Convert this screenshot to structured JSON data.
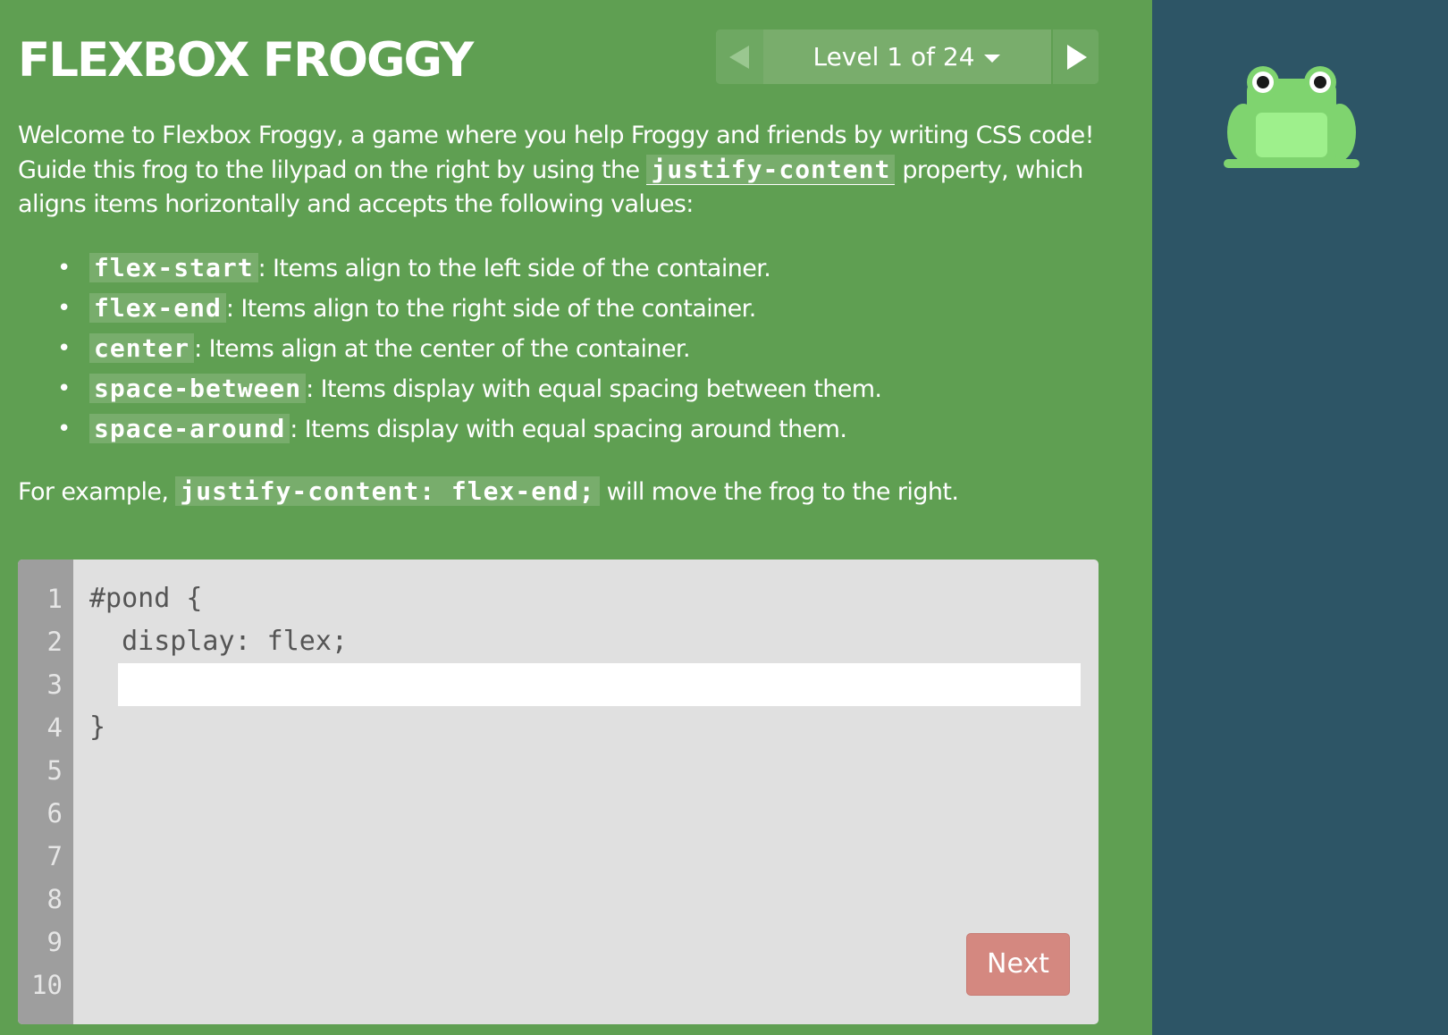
{
  "header": {
    "title": "FLEXBOX FROGGY",
    "level_label": "Level 1 of 24",
    "prev_icon": "triangle-left-icon",
    "next_icon": "triangle-right-icon",
    "dropdown_icon": "caret-down-icon"
  },
  "instructions": {
    "intro_1": "Welcome to Flexbox Froggy, a game where you help Froggy and friends by writing CSS code! Guide this frog to the lilypad on the right by using the",
    "property": "justify-content",
    "intro_2": "property, which aligns items horizontally and accepts the following values:",
    "values": [
      {
        "name": "flex-start",
        "description": ": Items align to the left side of the container."
      },
      {
        "name": "flex-end",
        "description": ": Items align to the right side of the container."
      },
      {
        "name": "center",
        "description": ": Items align at the center of the container."
      },
      {
        "name": "space-between",
        "description": ": Items display with equal spacing between them."
      },
      {
        "name": "space-around",
        "description": ": Items display with equal spacing around them."
      }
    ],
    "example_prefix": "For example,",
    "example_code": "justify-content: flex-end;",
    "example_suffix": "will move the frog to the right."
  },
  "editor": {
    "line_numbers": [
      "1",
      "2",
      "3",
      "4",
      "5",
      "6",
      "7",
      "8",
      "9",
      "10"
    ],
    "line_1": "#pond {",
    "line_2": "  display: flex;",
    "input_value": "",
    "line_4": "}",
    "next_label": "Next"
  },
  "board": {
    "frog_icon": "green-frog-icon"
  },
  "colors": {
    "sidebar_bg": "#5f9f52",
    "board_bg": "#2d5566",
    "editor_bg": "#e0e0e0",
    "gutter_bg": "#9e9e9e",
    "next_button": "#d48880",
    "frog_body": "#7fd46f",
    "frog_belly": "#9ef08c"
  }
}
